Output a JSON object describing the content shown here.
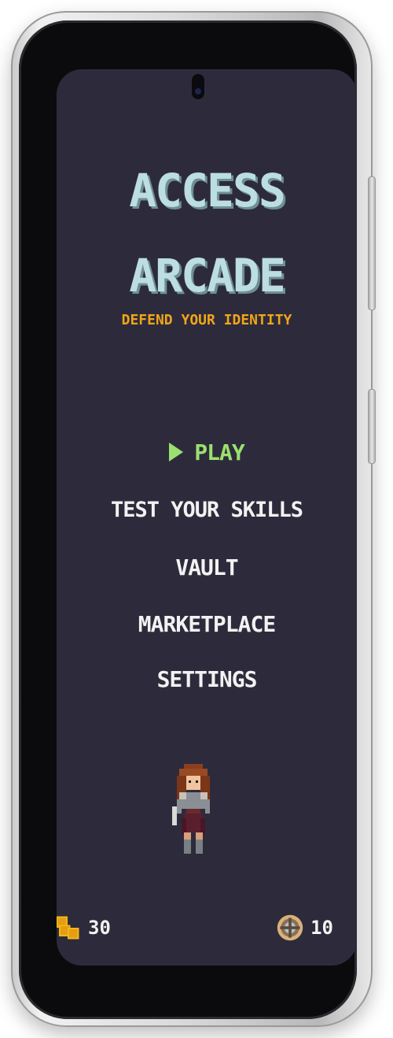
{
  "app": {
    "title_line_1": "ACCESS",
    "title_line_2": "ARCADE",
    "subtitle": "DEFEND YOUR IDENTITY"
  },
  "menu": {
    "items": [
      {
        "label": "PLAY",
        "selected": true
      },
      {
        "label": "TEST YOUR SKILLS",
        "selected": false
      },
      {
        "label": "VAULT",
        "selected": false
      },
      {
        "label": "MARKETPLACE",
        "selected": false
      },
      {
        "label": "SETTINGS",
        "selected": false
      }
    ]
  },
  "stats": {
    "coins": {
      "value": "30",
      "icon": "gold-coins-icon"
    },
    "tokens": {
      "value": "10",
      "icon": "shield-token-icon"
    }
  },
  "colors": {
    "screen_bg": "#2d2b3b",
    "title": "#bcdde2",
    "subtitle": "#f0a51a",
    "selected_menu": "#9be06e",
    "menu_text": "#f2f2f2"
  }
}
